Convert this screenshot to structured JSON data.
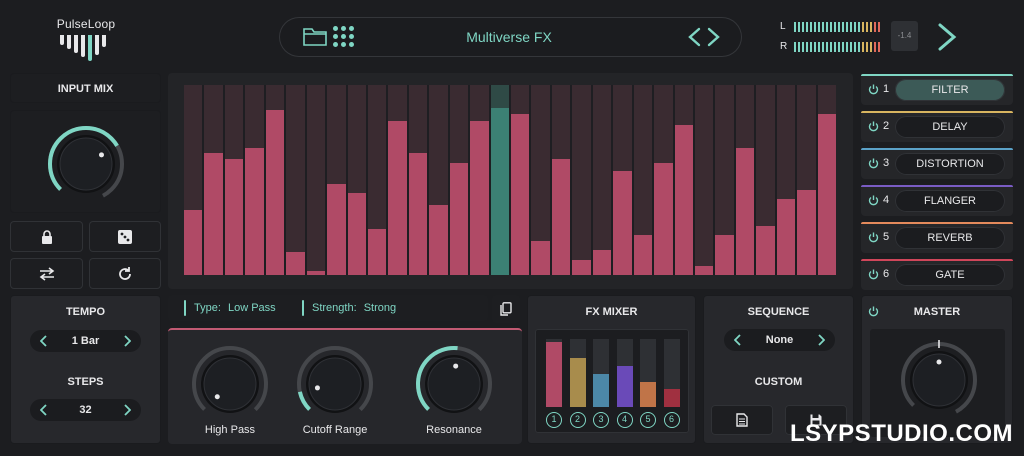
{
  "header": {
    "logo_text": "PulseLoop",
    "preset_name": "Multiverse FX",
    "meter_left_label": "L",
    "meter_right_label": "R",
    "peak_value": "-1.4"
  },
  "input_mix": {
    "label": "INPUT MIX",
    "level": 0.72
  },
  "sequencer": {
    "steps": [
      0.34,
      0.64,
      0.61,
      0.67,
      0.87,
      0.12,
      0.02,
      0.48,
      0.43,
      0.24,
      0.81,
      0.64,
      0.37,
      0.59,
      0.81,
      0.88,
      0.85,
      0.18,
      0.61,
      0.08,
      0.13,
      0.55,
      0.21,
      0.59,
      0.79,
      0.05,
      0.21,
      0.67,
      0.26,
      0.4,
      0.45,
      0.85
    ],
    "active_step": 15,
    "bar_color": "#b04a66",
    "active_color": "#3c8074"
  },
  "fx_chain": [
    {
      "num": "1",
      "name": "FILTER",
      "accent": "#7fd6c4",
      "active": true
    },
    {
      "num": "2",
      "name": "DELAY",
      "accent": "#d8b560"
    },
    {
      "num": "3",
      "name": "DISTORTION",
      "accent": "#5ba2c8"
    },
    {
      "num": "4",
      "name": "FLANGER",
      "accent": "#7a5cc4"
    },
    {
      "num": "5",
      "name": "REVERB",
      "accent": "#e48a5c"
    },
    {
      "num": "6",
      "name": "GATE",
      "accent": "#d0465a"
    }
  ],
  "filter": {
    "type_label": "Type:",
    "type_value": "Low Pass",
    "strength_label": "Strength:",
    "strength_value": "Strong",
    "knobs": [
      {
        "label": "High Pass",
        "value": 0.0
      },
      {
        "label": "Cutoff Range",
        "value": 0.12
      },
      {
        "label": "Resonance",
        "value": 0.52
      }
    ]
  },
  "tempo": {
    "label": "TEMPO",
    "value": "1 Bar"
  },
  "steps": {
    "label": "STEPS",
    "value": "32"
  },
  "fx_mixer": {
    "label": "FX MIXER",
    "channels": [
      {
        "num": "1",
        "level": 0.96,
        "color": "#b04a66"
      },
      {
        "num": "2",
        "level": 0.72,
        "color": "#a88c4c"
      },
      {
        "num": "3",
        "level": 0.48,
        "color": "#4c88a8"
      },
      {
        "num": "4",
        "level": 0.61,
        "color": "#6a4ab8"
      },
      {
        "num": "5",
        "level": 0.37,
        "color": "#c07448"
      },
      {
        "num": "6",
        "level": 0.26,
        "color": "#a03040"
      }
    ]
  },
  "sequence": {
    "label": "SEQUENCE",
    "value": "None",
    "custom_label": "CUSTOM"
  },
  "master": {
    "label": "MASTER",
    "level": 0.5
  },
  "watermark": "LSYPSTUDIO.COM"
}
